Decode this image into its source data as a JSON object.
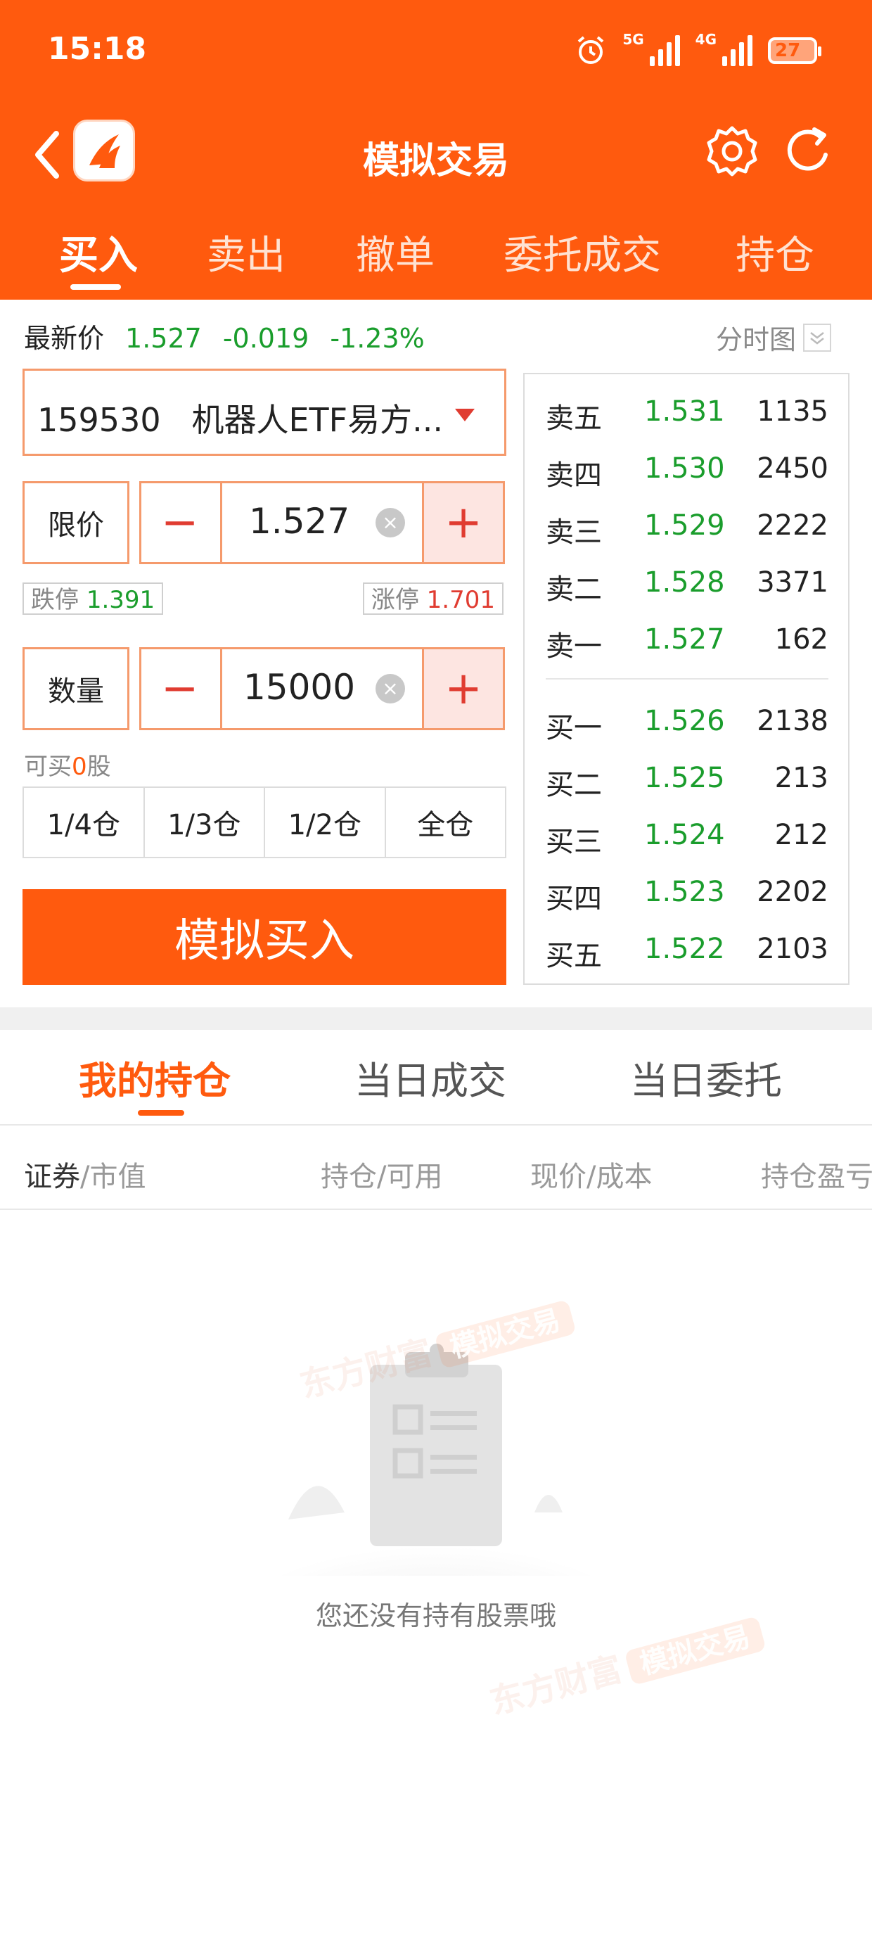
{
  "status_bar": {
    "time": "15:18",
    "network_5g": "5G",
    "network_4g": "4G",
    "battery": "27",
    "icons": [
      "alarm-icon",
      "signal-icon",
      "battery-icon"
    ]
  },
  "header": {
    "title": "模拟交易",
    "icons": [
      "back-icon",
      "app-logo-icon",
      "gear-icon",
      "refresh-icon"
    ],
    "tabs": [
      {
        "label": "买入",
        "active": true
      },
      {
        "label": "卖出",
        "active": false
      },
      {
        "label": "撤单",
        "active": false
      },
      {
        "label": "委托成交",
        "active": false
      },
      {
        "label": "持仓",
        "active": false
      }
    ]
  },
  "price_info": {
    "label": "最新价",
    "price": "1.527",
    "change": "-0.019",
    "change_pct": "-1.23%",
    "chart_link": "分时图"
  },
  "order_form": {
    "stock": "159530   机器人ETF易方...",
    "price_type": "限价",
    "price_value": "1.527",
    "limit_down_label": "跌停",
    "limit_down": "1.391",
    "limit_up_label": "涨停",
    "limit_up": "1.701",
    "qty_label": "数量",
    "qty_value": "15000",
    "can_buy_prefix": "可买",
    "can_buy_num": "0",
    "can_buy_suffix": "股",
    "position_buttons": [
      "1/4仓",
      "1/3仓",
      "1/2仓",
      "全仓"
    ],
    "submit": "模拟买入",
    "minus": "−",
    "plus": "+",
    "clear": "×"
  },
  "order_book": {
    "asks": [
      {
        "name": "卖五",
        "price": "1.531",
        "vol": "1135"
      },
      {
        "name": "卖四",
        "price": "1.530",
        "vol": "2450"
      },
      {
        "name": "卖三",
        "price": "1.529",
        "vol": "2222"
      },
      {
        "name": "卖二",
        "price": "1.528",
        "vol": "3371"
      },
      {
        "name": "卖一",
        "price": "1.527",
        "vol": "162"
      }
    ],
    "bids": [
      {
        "name": "买一",
        "price": "1.526",
        "vol": "2138"
      },
      {
        "name": "买二",
        "price": "1.525",
        "vol": "213"
      },
      {
        "name": "买三",
        "price": "1.524",
        "vol": "212"
      },
      {
        "name": "买四",
        "price": "1.523",
        "vol": "2202"
      },
      {
        "name": "买五",
        "price": "1.522",
        "vol": "2103"
      }
    ]
  },
  "holdings": {
    "tabs": [
      {
        "label": "我的持仓",
        "active": true
      },
      {
        "label": "当日成交",
        "active": false
      },
      {
        "label": "当日委托",
        "active": false
      }
    ],
    "columns": {
      "c1a": "证券",
      "c1b": "/市值",
      "c2": "持仓/可用",
      "c3": "现价/成本",
      "c4": "持仓盈亏"
    },
    "empty_text": "您还没有持有股票哦"
  },
  "watermark": {
    "brand": "东方财富",
    "tag": "模拟交易"
  },
  "colors": {
    "brand": "#FF5A0E",
    "down": "#1A9D2C",
    "up": "#E03C31"
  }
}
